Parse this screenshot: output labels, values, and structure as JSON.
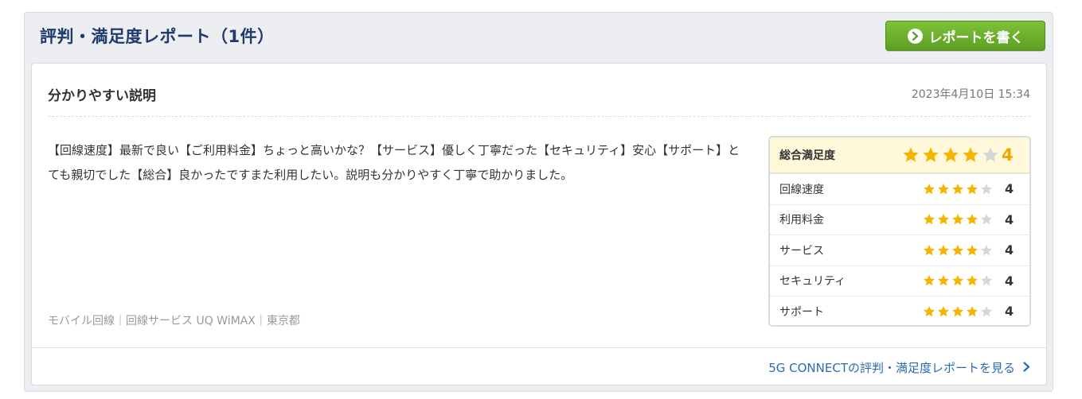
{
  "header": {
    "title": "評判・満足度レポート（1件）",
    "write_button_label": "レポートを書く"
  },
  "review": {
    "title": "分かりやすい説明",
    "date": "2023年4月10日 15:34",
    "body": "【回線速度】最新で良い【ご利用料金】ちょっと高いかな？【サービス】優しく丁寧だった【セキュリティ】安心【サポート】とても親切でした【総合】良かったですまた利用したい。説明も分かりやすく丁寧で助かりました。",
    "meta": "モバイル回線｜回線サービス UQ WiMAX｜東京都"
  },
  "ratings": {
    "total": {
      "label": "総合満足度",
      "value": "4",
      "stars": 4,
      "max": 5
    },
    "items": [
      {
        "label": "回線速度",
        "value": "4",
        "stars": 4,
        "max": 5
      },
      {
        "label": "利用料金",
        "value": "4",
        "stars": 4,
        "max": 5
      },
      {
        "label": "サービス",
        "value": "4",
        "stars": 4,
        "max": 5
      },
      {
        "label": "セキュリティ",
        "value": "4",
        "stars": 4,
        "max": 5
      },
      {
        "label": "サポート",
        "value": "4",
        "stars": 4,
        "max": 5
      }
    ]
  },
  "footer": {
    "more_link": "5G CONNECTの評判・満足度レポートを見る"
  },
  "colors": {
    "accent_green": "#6cb02e",
    "title_navy": "#1f3a6e",
    "star_filled": "#f5b400",
    "star_empty": "#d6d6d6",
    "link_blue": "#2a6bb5"
  },
  "icons": {
    "write_button_icon": "arrow-right-circle-icon",
    "more_link_icon": "chevron-right-icon",
    "star_icon": "star-icon"
  }
}
